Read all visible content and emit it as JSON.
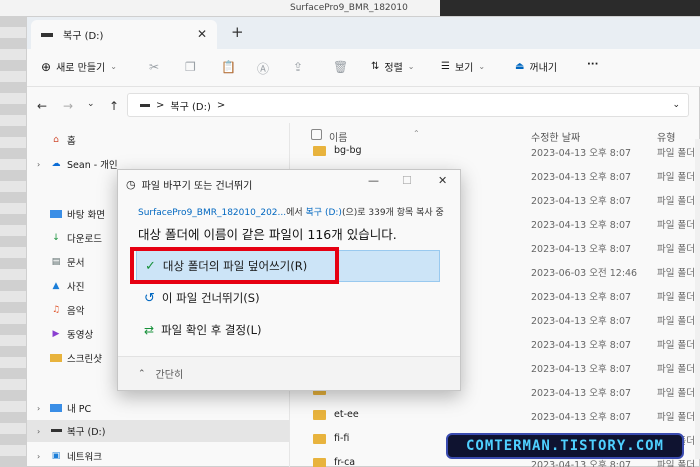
{
  "background": {
    "tab_text": "SurfacePro9_BMR_182010"
  },
  "window": {
    "tab_title": "복구 (D:)",
    "close_tab": "✕",
    "new_tab": "+"
  },
  "toolbar": {
    "new_label": "새로 만들기",
    "sort_label": "정렬",
    "view_label": "보기",
    "eject_label": "꺼내기",
    "more_label": "···"
  },
  "address": {
    "path": "복구 (D:)",
    "sep": ">"
  },
  "sidebar": {
    "items": [
      {
        "label": "홈"
      },
      {
        "label": "Sean - 개인"
      },
      {
        "label": "바탕 화면"
      },
      {
        "label": "다운로드"
      },
      {
        "label": "문서"
      },
      {
        "label": "사진"
      },
      {
        "label": "음악"
      },
      {
        "label": "동영상"
      },
      {
        "label": "스크린샷"
      },
      {
        "label": "내 PC"
      },
      {
        "label": "복구 (D:)"
      },
      {
        "label": "네트워크"
      }
    ]
  },
  "columns": {
    "name": "이름",
    "modified": "수정한 날짜",
    "type": "유형"
  },
  "files": [
    {
      "name": "bg-bg",
      "date": "2023-04-13 오후 8:07",
      "type": "파일 폴더"
    },
    {
      "name": "",
      "date": "2023-04-13 오후 8:07",
      "type": "파일 폴더"
    },
    {
      "name": "",
      "date": "2023-04-13 오후 8:07",
      "type": "파일 폴더"
    },
    {
      "name": "",
      "date": "2023-04-13 오후 8:07",
      "type": "파일 폴더"
    },
    {
      "name": "",
      "date": "2023-04-13 오후 8:07",
      "type": "파일 폴더"
    },
    {
      "name": "",
      "date": "2023-06-03 오전 12:46",
      "type": "파일 폴더"
    },
    {
      "name": "",
      "date": "2023-04-13 오후 8:07",
      "type": "파일 폴더"
    },
    {
      "name": "",
      "date": "2023-04-13 오후 8:07",
      "type": "파일 폴더"
    },
    {
      "name": "",
      "date": "2023-04-13 오후 8:07",
      "type": "파일 폴더"
    },
    {
      "name": "",
      "date": "2023-04-13 오후 8:07",
      "type": "파일 폴더"
    },
    {
      "name": "",
      "date": "2023-04-13 오후 8:07",
      "type": "파일 폴더"
    },
    {
      "name": "et-ee",
      "date": "2023-04-13 오후 8:07",
      "type": "파일 폴더"
    },
    {
      "name": "fi-fi",
      "date": "2023-04-13 오후 8:07",
      "type": "파일 폴더"
    },
    {
      "name": "fr-ca",
      "date": "2023-04-13 오후 8:07",
      "type": "파일 폴더"
    }
  ],
  "dialog": {
    "title": "파일 바꾸기 또는 건너뛰기",
    "source": "SurfacePro9_BMR_182010_202...",
    "source_mid": "에서 ",
    "dest": "복구 (D:)",
    "source_tail": "(으)로 339개 항목 복사 중",
    "message": "대상 폴더에 이름이 같은 파일이 116개 있습니다.",
    "option_replace": "대상 폴더의 파일 덮어쓰기(R)",
    "option_skip": "이 파일 건너뛰기(S)",
    "option_decide": "파일 확인 후 결정(L)",
    "fewer": "간단히",
    "minimize": "—",
    "maximize": "☐",
    "close": "✕"
  },
  "watermark": "COMTERMAN.TISTORY.COM"
}
